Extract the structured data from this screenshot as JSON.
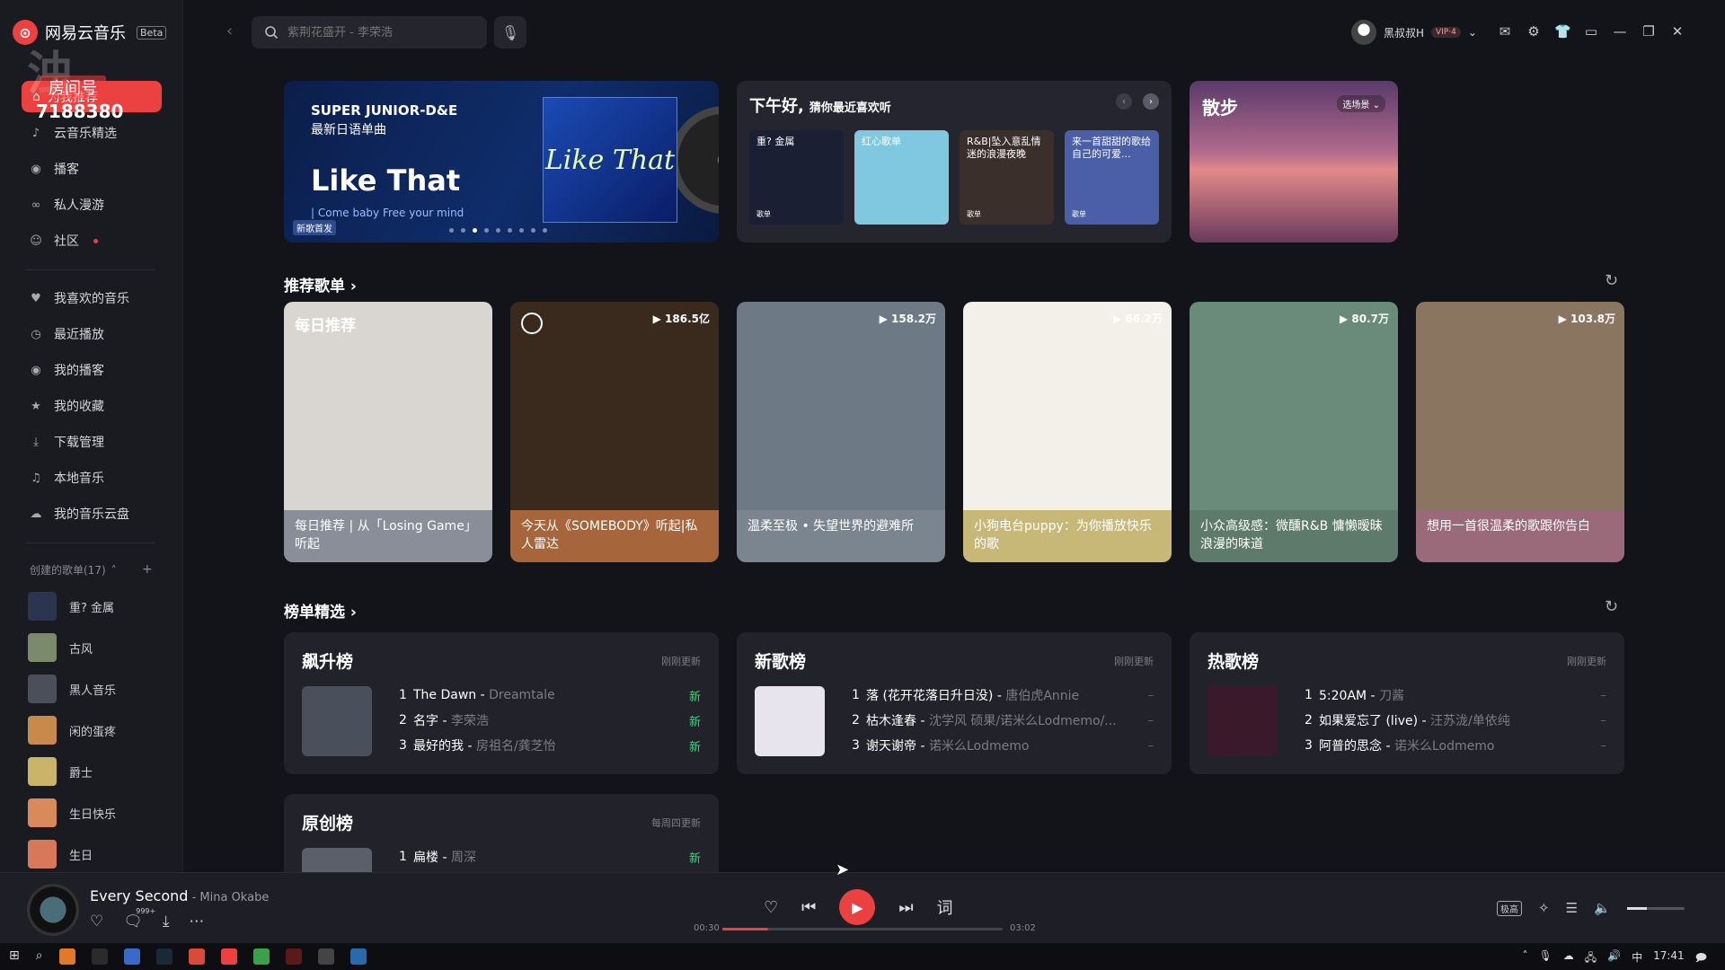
{
  "app": {
    "logo_text": "网易云音乐",
    "beta": "Beta"
  },
  "watermark": {
    "big": "浊",
    "tag": "房间号",
    "number": "7188380"
  },
  "sidebar": {
    "active_item": "为我推荐",
    "items": [
      {
        "label": "云音乐精选",
        "icon": "music-note-icon"
      },
      {
        "label": "播客",
        "icon": "podcast-icon"
      },
      {
        "label": "私人漫游",
        "icon": "roam-icon"
      },
      {
        "label": "社区",
        "icon": "community-icon",
        "dot": true
      }
    ],
    "my_items": [
      {
        "label": "我喜欢的音乐",
        "icon": "heart-icon"
      },
      {
        "label": "最近播放",
        "icon": "clock-icon"
      },
      {
        "label": "我的播客",
        "icon": "podcast-icon"
      },
      {
        "label": "我的收藏",
        "icon": "star-icon"
      },
      {
        "label": "下载管理",
        "icon": "download-icon"
      },
      {
        "label": "本地音乐",
        "icon": "local-music-icon"
      },
      {
        "label": "我的音乐云盘",
        "icon": "cloud-icon"
      }
    ],
    "playlists_title": "创建的歌单(17)",
    "playlists": [
      {
        "label": "重? 金属",
        "color": "#2b3550"
      },
      {
        "label": "古风",
        "color": "#7a8a6a"
      },
      {
        "label": "黑人音乐",
        "color": "#4a4f5a"
      },
      {
        "label": "闲的蛋疼",
        "color": "#c88a4a"
      },
      {
        "label": "爵士",
        "color": "#c9b46a"
      },
      {
        "label": "生日快乐",
        "color": "#d88a5a"
      },
      {
        "label": "生日",
        "color": "#d8785a"
      }
    ]
  },
  "search": {
    "placeholder": "紫荆花盛开 - 李荣浩"
  },
  "user": {
    "name": "黑叔叔H",
    "vip": "VIP·4"
  },
  "banner": {
    "line1": "SUPER JUNIOR-D&E",
    "line2": "最新日语单曲",
    "title": "Like That",
    "subtitle": "| Come baby Free your mind",
    "tag": "新歌首发",
    "album_text": "Like That"
  },
  "recommend_panel": {
    "title": "下午好,",
    "subtitle": "猜你最近喜欢听",
    "cards": [
      {
        "label": "重? 金属",
        "tag": "歌单",
        "color": "#1a1f33"
      },
      {
        "label": "红心歌单",
        "tag": "",
        "color": "#7fc8e0"
      },
      {
        "label": "R&B|坠入意乱情迷的浪漫夜晚",
        "tag": "歌单",
        "color": "#3a2f2a"
      },
      {
        "label": "来一首甜甜的歌给自己的可爱...",
        "tag": "歌单",
        "color": "#4a5fa8"
      }
    ]
  },
  "walk": {
    "title": "散步",
    "selector": "选场景"
  },
  "sections": {
    "playlists": "推荐歌单",
    "charts": "榜单精选"
  },
  "playlist_cards": [
    {
      "caption": "每日推荐 | 从「Losing Game」听起",
      "count": "",
      "badge": "每日推荐",
      "img": "#d9d6d2",
      "cap_bg": "#8a8e99"
    },
    {
      "caption": "今天从《SOMEBODY》听起|私人雷达",
      "count": "186.5亿",
      "badge": "",
      "img": "#3a2a1e",
      "cap_bg": "#a6653a"
    },
    {
      "caption": "温柔至极 • 失望世界的避难所",
      "count": "158.2万",
      "badge": "",
      "img": "#6d7a86",
      "cap_bg": "#7b8590"
    },
    {
      "caption": "小狗电台puppy：为你播放快乐的歌",
      "count": "66.2万",
      "badge": "",
      "img": "#f2f0e8",
      "cap_bg": "#c8b878"
    },
    {
      "caption": "小众高级感：微醺R&B 慵懒暧昧 浪漫的味道",
      "count": "80.7万",
      "badge": "",
      "img": "#6a8a7a",
      "cap_bg": "#5d7a6a"
    },
    {
      "caption": "想用一首很温柔的歌跟你告白",
      "count": "103.8万",
      "badge": "",
      "img": "#8a7560",
      "cap_bg": "#9a6a7a"
    }
  ],
  "ranks": [
    {
      "title": "飙升榜",
      "update": "刚刚更新",
      "color": "#4a4f5c",
      "rows": [
        {
          "n": "1",
          "song": "The Dawn",
          "artist": "Dreamtale",
          "trend": "新"
        },
        {
          "n": "2",
          "song": "名字",
          "artist": "李荣浩",
          "trend": "新"
        },
        {
          "n": "3",
          "song": "最好的我",
          "artist": "房祖名/龚芝怡",
          "trend": "新"
        }
      ]
    },
    {
      "title": "新歌榜",
      "update": "刚刚更新",
      "color": "#e8e4ee",
      "rows": [
        {
          "n": "1",
          "song": "落 (花开花落日升日没)",
          "artist": "唐伯虎Annie",
          "trend": "–"
        },
        {
          "n": "2",
          "song": "枯木逢春",
          "artist": "沈学风 硕果/诺米么Lodmemo/...",
          "trend": "–"
        },
        {
          "n": "3",
          "song": "谢天谢帝",
          "artist": "诺米么Lodmemo",
          "trend": "–"
        }
      ]
    },
    {
      "title": "热歌榜",
      "update": "刚刚更新",
      "color": "#3a1a2a",
      "rows": [
        {
          "n": "1",
          "song": "5:20AM",
          "artist": "刀酱",
          "trend": "–"
        },
        {
          "n": "2",
          "song": "如果爱忘了 (live)",
          "artist": "汪苏泷/单依纯",
          "trend": "–"
        },
        {
          "n": "3",
          "song": "阿普的思念",
          "artist": "诺米么Lodmemo",
          "trend": "–"
        }
      ]
    },
    {
      "title": "原创榜",
      "update": "每周四更新",
      "color": "#5a5f6a",
      "rows": [
        {
          "n": "1",
          "song": "扁楼",
          "artist": "周深",
          "trend": "新"
        }
      ]
    }
  ],
  "player": {
    "song": "Every Second",
    "artist": "Mina Okabe",
    "comments": "999+",
    "elapsed": "00:30",
    "total": "03:02",
    "progress": 0.165,
    "quality": "极高",
    "lyrics_btn": "词"
  },
  "taskbar": {
    "time": "17:41",
    "ime": "中"
  }
}
